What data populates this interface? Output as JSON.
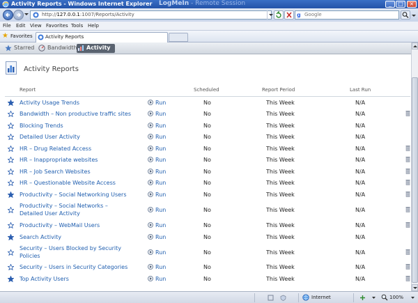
{
  "window": {
    "title": "Activity Reports - Windows Internet Explorer",
    "remote_watermark_brand": "LogMeIn",
    "remote_watermark_text": " - Remote Session",
    "minimize": "_",
    "maximize": "□",
    "close": "×"
  },
  "address_bar": {
    "url_prefix": "http://",
    "url_host": "127.0.0.1",
    "url_path": ":1007/Reports/Activity"
  },
  "search": {
    "placeholder": "Google",
    "engine_glyph": "g"
  },
  "menu": {
    "items": [
      "File",
      "Edit",
      "View",
      "Favorites",
      "Tools",
      "Help"
    ]
  },
  "favorites_bar": {
    "favorites_label": "Favorites",
    "tab_title": "Activity Reports"
  },
  "app_nav": {
    "items": [
      "Starred",
      "Bandwidth",
      "Activity"
    ],
    "active": "Activity"
  },
  "page": {
    "title": "Activity Reports"
  },
  "table": {
    "headers": {
      "report": "Report",
      "scheduled": "Scheduled",
      "period": "Report Period",
      "last_run": "Last Run"
    },
    "run_label": "Run",
    "rows": [
      {
        "name": "Activity Usage Trends",
        "scheduled": "No",
        "period": "This Week",
        "last_run": "N/A",
        "starred": true,
        "deletable": false
      },
      {
        "name": "Bandwidth – Non productive traffic sites",
        "scheduled": "No",
        "period": "This Week",
        "last_run": "N/A",
        "starred": false,
        "deletable": true
      },
      {
        "name": "Blocking Trends",
        "scheduled": "No",
        "period": "This Week",
        "last_run": "N/A",
        "starred": false,
        "deletable": false
      },
      {
        "name": "Detailed User Activity",
        "scheduled": "No",
        "period": "This Week",
        "last_run": "N/A",
        "starred": false,
        "deletable": false
      },
      {
        "name": "HR – Drug Related Access",
        "scheduled": "No",
        "period": "This Week",
        "last_run": "N/A",
        "starred": false,
        "deletable": true
      },
      {
        "name": "HR – Inappropriate websites",
        "scheduled": "No",
        "period": "This Week",
        "last_run": "N/A",
        "starred": false,
        "deletable": true
      },
      {
        "name": "HR – Job Search Websites",
        "scheduled": "No",
        "period": "This Week",
        "last_run": "N/A",
        "starred": false,
        "deletable": true
      },
      {
        "name": "HR – Questionable Website Access",
        "scheduled": "No",
        "period": "This Week",
        "last_run": "N/A",
        "starred": false,
        "deletable": true
      },
      {
        "name": "Productivity – Social Networking Users",
        "scheduled": "No",
        "period": "This Week",
        "last_run": "N/A",
        "starred": true,
        "deletable": true
      },
      {
        "name": "Productivity – Social Networks – Detailed User Activity",
        "scheduled": "No",
        "period": "This Week",
        "last_run": "N/A",
        "starred": false,
        "deletable": true
      },
      {
        "name": "Productivity – WebMail Users",
        "scheduled": "No",
        "period": "This Week",
        "last_run": "N/A",
        "starred": false,
        "deletable": true
      },
      {
        "name": "Search Activity",
        "scheduled": "No",
        "period": "This Week",
        "last_run": "N/A",
        "starred": true,
        "deletable": false
      },
      {
        "name": "Security – Users Blocked by Security Policies",
        "scheduled": "No",
        "period": "This Week",
        "last_run": "N/A",
        "starred": false,
        "deletable": true
      },
      {
        "name": "Security – Users in Security Categories",
        "scheduled": "No",
        "period": "This Week",
        "last_run": "N/A",
        "starred": false,
        "deletable": true
      },
      {
        "name": "Top Activity Users",
        "scheduled": "No",
        "period": "This Week",
        "last_run": "N/A",
        "starred": true,
        "deletable": true
      }
    ]
  },
  "status_bar": {
    "zone": "Internet",
    "zoom": "100%"
  },
  "colors": {
    "link": "#2260b0",
    "title_bar": "#2453a8",
    "active_nav": "#5a6370",
    "star_filled": "#2c5fb0"
  }
}
